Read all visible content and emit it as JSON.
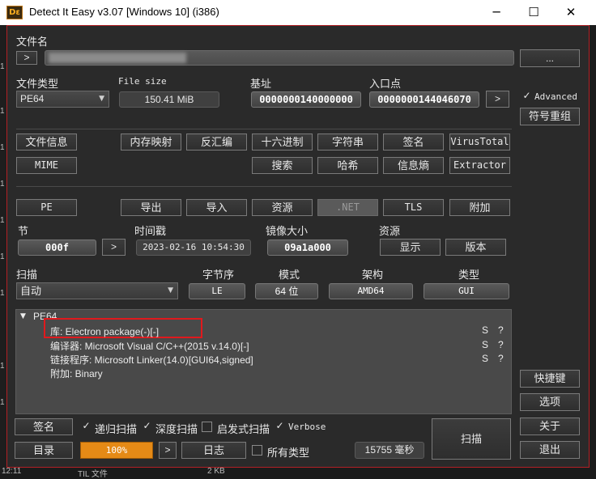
{
  "window": {
    "title": "Detect It Easy v3.07 [Windows 10] (i386)",
    "icon_text": "Dε",
    "minimize_glyph": "─",
    "maximize_glyph": "☐",
    "close_glyph": "✕"
  },
  "file": {
    "label": "文件名",
    "nav_button": ">",
    "browse_button": "...",
    "path": ""
  },
  "info": {
    "filetype_label": "文件类型",
    "filetype_value": "PE64",
    "filesize_label": "File size",
    "filesize_value": "150.41 MiB",
    "base_label": "基址",
    "base_value": "0000000140000000",
    "entry_label": "入口点",
    "entry_value": "0000000144046070",
    "entry_button": ">",
    "advanced_label": "Advanced",
    "advanced_checked": "✓",
    "reloc_button": "符号重组"
  },
  "tools_row1": [
    "文件信息",
    "内存映射",
    "反汇编",
    "十六进制",
    "字符串",
    "签名",
    "VirusTotal"
  ],
  "tools_row2": [
    "MIME",
    "搜索",
    "哈希",
    "信息熵",
    "Extractor"
  ],
  "pe_row": {
    "pe": "PE",
    "export": "导出",
    "import": "导入",
    "resource": "资源",
    "dotnet": ".NET",
    "tls": "TLS",
    "overlay": "附加"
  },
  "section": {
    "section_label": "节",
    "section_value": "000f",
    "section_button": ">",
    "time_label": "时间戳",
    "time_value": "2023-02-16 10:54:30",
    "image_label": "镜像大小",
    "image_value": "09a1a000",
    "res_label": "资源",
    "show_button": "显示",
    "version_button": "版本"
  },
  "scan": {
    "scan_label": "扫描",
    "scan_value": "自动",
    "endian_label": "字节序",
    "endian_value": "LE",
    "mode_label": "模式",
    "mode_value": "64 位",
    "arch_label": "架构",
    "arch_value": "AMD64",
    "type_label": "类型",
    "type_value": "GUI"
  },
  "results": {
    "root": "PE64",
    "expander": "▼",
    "items": [
      {
        "text": "库: Electron package(-)[-]",
        "s": "S",
        "q": "?"
      },
      {
        "text": "编译器: Microsoft Visual C/C++(2015 v.14.0)[-]",
        "s": "S",
        "q": "?"
      },
      {
        "text": "链接程序: Microsoft Linker(14.0)[GUI64,signed]",
        "s": "S",
        "q": "?"
      },
      {
        "text": "附加: Binary",
        "s": "",
        "q": ""
      }
    ]
  },
  "bottom": {
    "signatures_button": "签名",
    "recursive_label": "递归扫描",
    "recursive_check": "✓",
    "deep_label": "深度扫描",
    "deep_check": "✓",
    "heuristic_label": "启发式扫描",
    "heuristic_check": "",
    "verbose_label": "Verbose",
    "verbose_check": "✓",
    "directory_button": "目录",
    "progress_text": "100%",
    "progress_percent": 100,
    "next_button": ">",
    "log_button": "日志",
    "alltypes_label": "所有类型",
    "alltypes_check": "",
    "time_value": "15755 毫秒",
    "scan_button": "扫描"
  },
  "side": {
    "shortcuts": "快捷键",
    "options": "选项",
    "about": "关于",
    "exit": "退出"
  },
  "background": {
    "left_digits": [
      "1",
      "1",
      "1",
      "1",
      "1",
      "1",
      "1",
      "1",
      "1"
    ],
    "bottom_time": "12:11",
    "bottom_file": "TIL 文件",
    "bottom_size": "2 KB"
  },
  "colors": {
    "accent_border": "#b32025",
    "highlight": "#e0191d",
    "progress": "#e58a16"
  }
}
